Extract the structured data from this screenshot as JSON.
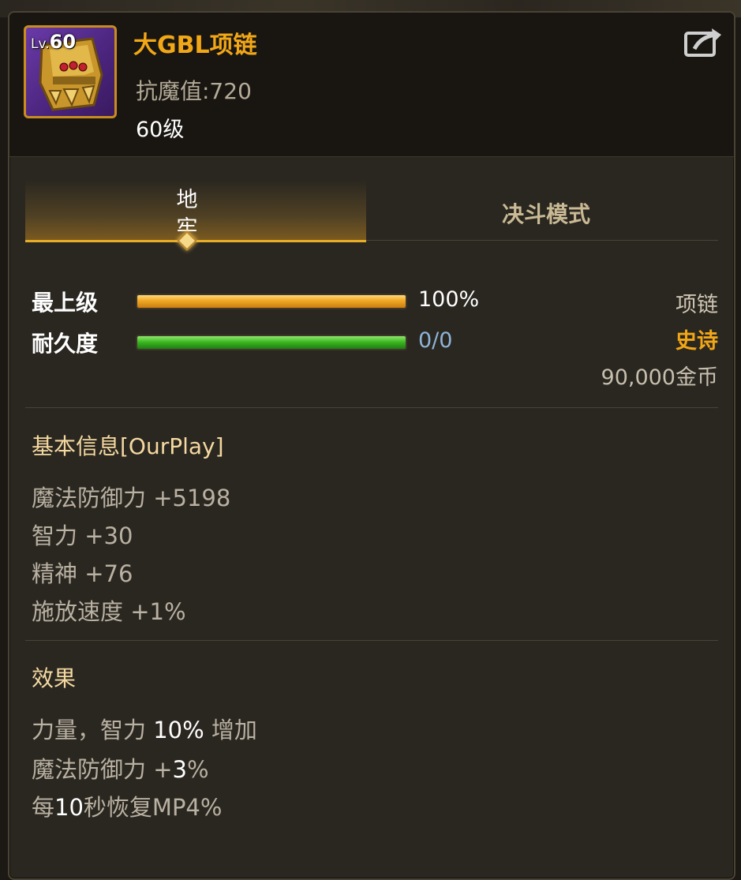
{
  "item": {
    "level_badge_prefix": "Lv.",
    "level_badge_number": "60",
    "name": "大GBL项链",
    "magic_resistance": "抗魔值:720",
    "level_requirement": "60级"
  },
  "tabs": [
    {
      "label": "地牢",
      "active": true
    },
    {
      "label": "决斗模式",
      "active": false
    }
  ],
  "bars": {
    "grade": {
      "label": "最上级",
      "value_text": "100%",
      "fill_fraction": 1.0
    },
    "durability": {
      "label": "耐久度",
      "value_text": "0/0",
      "fill_fraction": 1.0
    }
  },
  "item_info": {
    "type": "项链",
    "rarity": "史诗",
    "price": "90,000金币"
  },
  "basic_info": {
    "title": "基本信息[OurPlay]",
    "stats": [
      "魔法防御力 +5198",
      "智力 +30",
      "精神 +76",
      "施放速度 +1%"
    ]
  },
  "effects": {
    "title": "效果",
    "lines": [
      {
        "before": "力量，智力 ",
        "value": "10%",
        "after": " 增加"
      },
      {
        "before": "魔法防御力 +",
        "value": "3",
        "after": "%"
      },
      {
        "before": "每",
        "value": "10",
        "after": "秒恢复MP4%"
      }
    ]
  },
  "colors": {
    "item_name": "#f2a716",
    "rarity_epic": "#f2a716",
    "bar_gold": "#f0a823",
    "bar_green": "#38b21f",
    "durability_value": "#8fb4d8",
    "tab_underline": "#e7ad27"
  },
  "icons": {
    "share": "share-icon",
    "item": "golden-mask-necklace-icon"
  }
}
